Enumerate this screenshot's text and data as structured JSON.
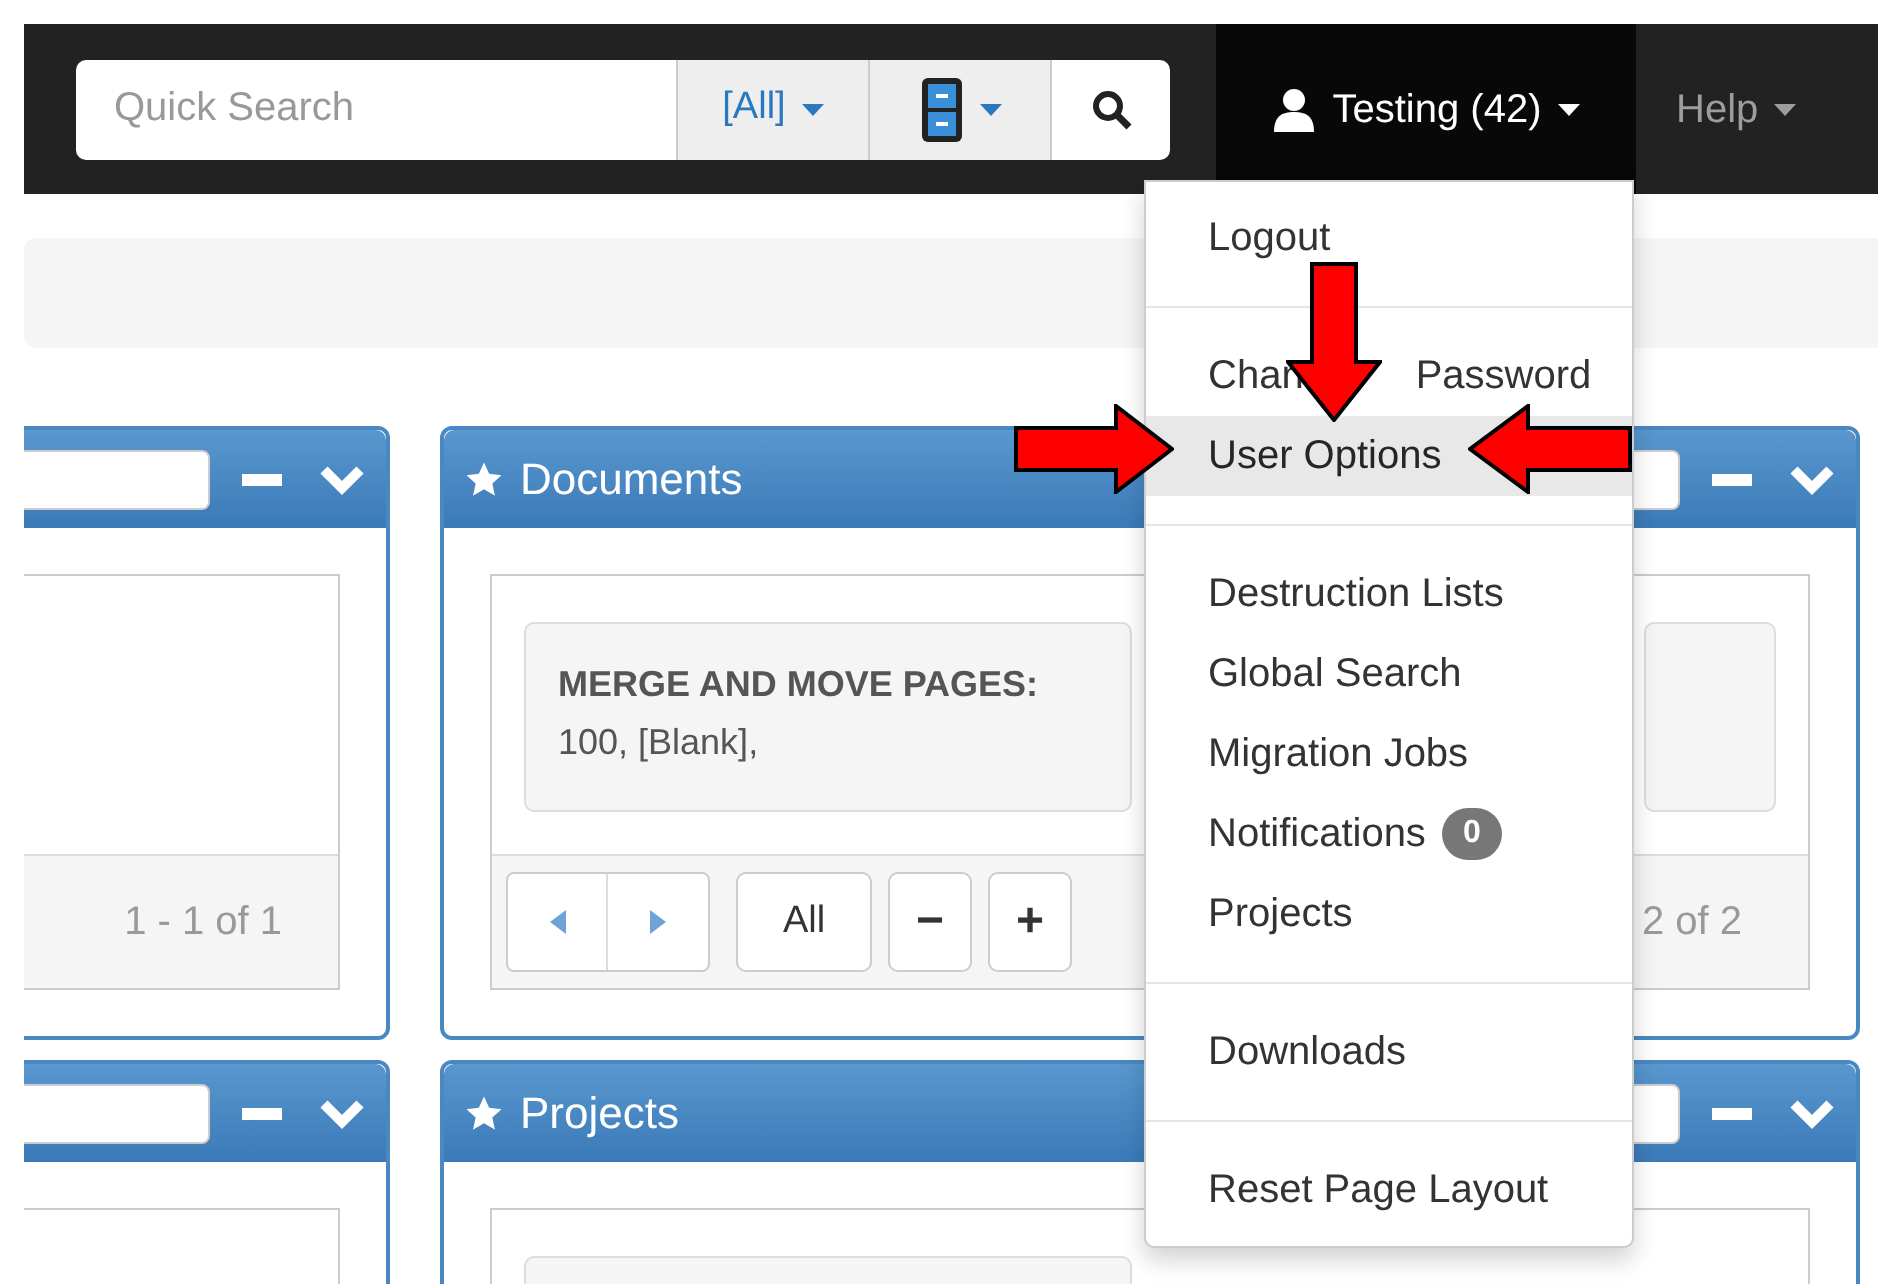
{
  "navbar": {
    "search": {
      "placeholder": "Quick Search"
    },
    "scope": "[All]",
    "user": {
      "label": "Testing (42)",
      "open": true
    },
    "help": "Help"
  },
  "left_panels": [
    {
      "pager": "1 - 1 of 1"
    }
  ],
  "documents": {
    "title": "Documents",
    "cards": [
      {
        "text": "**MERGE AND MOVE PAGES:** 100, [Blank],"
      }
    ],
    "buttons": [
      "All",
      "−",
      "+"
    ],
    "pager": "2 of 2"
  },
  "projects": {
    "title": "Projects"
  },
  "user_menu": [
    [
      {
        "label_parts": [
          "Logout"
        ],
        "selected": false
      }
    ],
    [
      {
        "label_parts": [
          "Chan",
          "Password"
        ],
        "selected": false
      },
      {
        "label_parts": [
          "User Options"
        ],
        "selected": true
      }
    ],
    [
      {
        "label_parts": [
          "Destruction Lists"
        ],
        "selected": false
      },
      {
        "label_parts": [
          "Global Search"
        ],
        "selected": false
      },
      {
        "label_parts": [
          "Migration Jobs"
        ],
        "selected": false
      },
      {
        "label_parts": [
          "Notifications"
        ],
        "badge": "0",
        "selected": false
      },
      {
        "label_parts": [
          "Projects"
        ],
        "selected": false
      }
    ],
    [
      {
        "label_parts": [
          "Downloads"
        ],
        "selected": false
      }
    ],
    [
      {
        "label_parts": [
          "Reset Page Layout"
        ],
        "selected": false
      }
    ]
  ]
}
